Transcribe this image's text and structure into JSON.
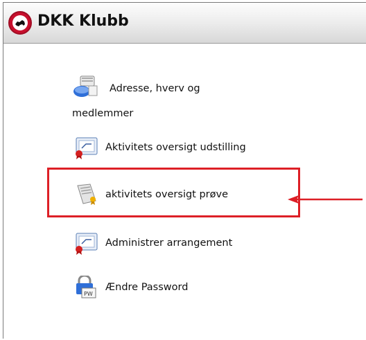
{
  "header": {
    "title": "DKK Klubb"
  },
  "menu": {
    "items": [
      {
        "label_line1": "Adresse, hverv og",
        "label_line2": "medlemmer",
        "icon": "address-book-icon"
      },
      {
        "label": "Aktivitets oversigt udstilling",
        "icon": "certificate-icon"
      },
      {
        "label": "aktivitets oversigt prøve",
        "icon": "document-ribbon-icon",
        "highlighted": true
      },
      {
        "label": "Administrer arrangement",
        "icon": "certificate-icon"
      },
      {
        "label": "Ændre Password",
        "icon": "password-lock-icon"
      }
    ]
  },
  "annotation": {
    "highlight_color": "#dd1f26",
    "arrow_color": "#dd1f26"
  }
}
